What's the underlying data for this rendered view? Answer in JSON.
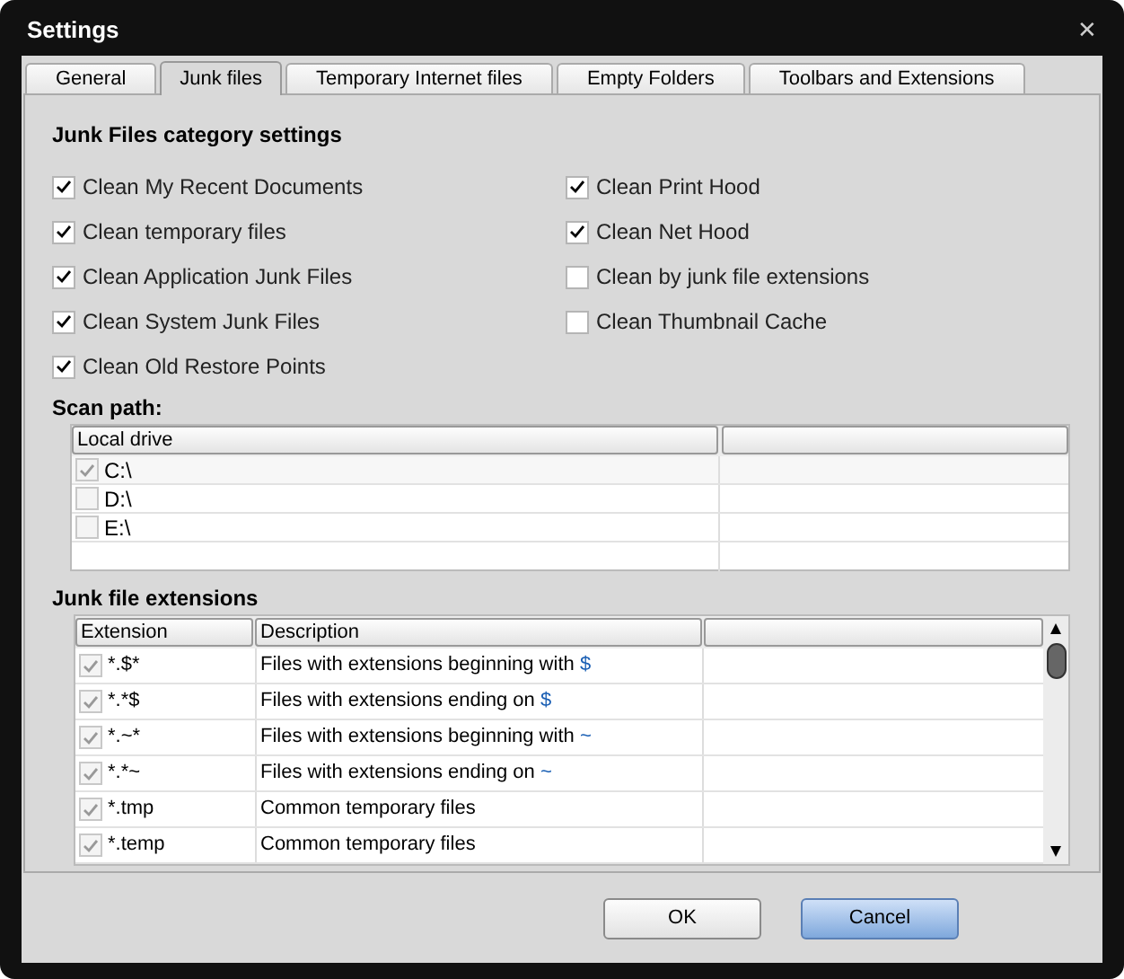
{
  "window": {
    "title": "Settings",
    "close": "✕"
  },
  "tabs": [
    {
      "label": "General",
      "selected": false
    },
    {
      "label": "Junk files",
      "selected": true
    },
    {
      "label": "Temporary Internet files",
      "selected": false
    },
    {
      "label": "Empty Folders",
      "selected": false
    },
    {
      "label": "Toolbars and Extensions",
      "selected": false
    }
  ],
  "category": {
    "heading": "Junk Files category settings",
    "options": [
      {
        "label": "Clean My Recent Documents",
        "checked": true
      },
      {
        "label": "Clean temporary files",
        "checked": true
      },
      {
        "label": "Clean Application Junk Files",
        "checked": true
      },
      {
        "label": "Clean System Junk Files",
        "checked": true
      },
      {
        "label": "Clean Old Restore Points",
        "checked": true
      },
      {
        "label": "Clean Print Hood",
        "checked": true
      },
      {
        "label": "Clean Net Hood",
        "checked": true
      },
      {
        "label": "Clean by junk file extensions",
        "checked": false
      },
      {
        "label": "Clean Thumbnail Cache",
        "checked": false
      }
    ]
  },
  "scan_path": {
    "heading": "Scan path:",
    "columns": [
      "Local drive"
    ],
    "rows": [
      {
        "drive": "C:\\",
        "checked": true
      },
      {
        "drive": "D:\\",
        "checked": false
      },
      {
        "drive": "E:\\",
        "checked": false
      }
    ]
  },
  "extensions": {
    "heading": "Junk file extensions",
    "columns": [
      "Extension",
      "Description"
    ],
    "rows": [
      {
        "extension": "*.$*",
        "description": "Files with extensions beginning with",
        "symbol": "$",
        "checked": true
      },
      {
        "extension": "*.*$",
        "description": "Files with extensions ending on",
        "symbol": "$",
        "checked": true
      },
      {
        "extension": "*.~*",
        "description": "Files with extensions beginning with",
        "symbol": "~",
        "checked": true
      },
      {
        "extension": "*.*~",
        "description": "Files with extensions ending on",
        "symbol": "~",
        "checked": true
      },
      {
        "extension": "*.tmp",
        "description": "Common temporary files",
        "checked": true
      },
      {
        "extension": "*.temp",
        "description": "Common temporary files",
        "checked": true
      }
    ]
  },
  "buttons": [
    {
      "label": "OK",
      "kind": "plain"
    },
    {
      "label": "Cancel",
      "kind": "default"
    }
  ]
}
